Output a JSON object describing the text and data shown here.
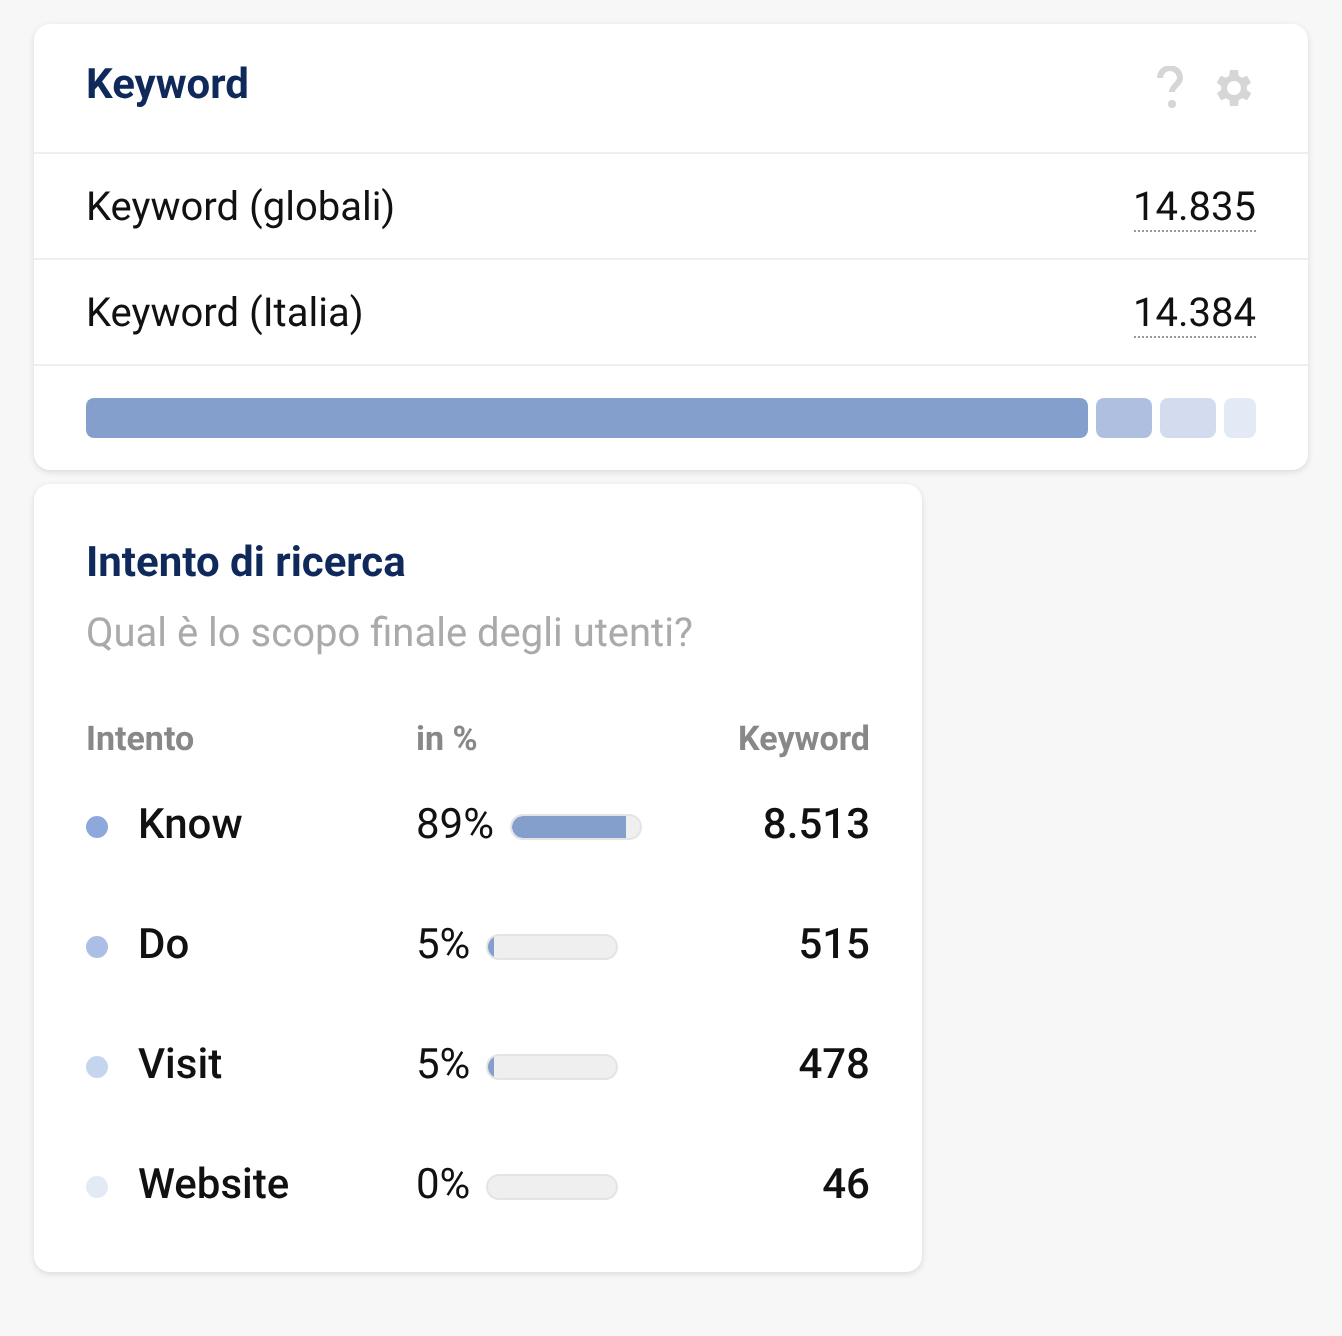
{
  "keyword_card": {
    "title": "Keyword",
    "rows": [
      {
        "label": "Keyword (globali)",
        "value": "14.835"
      },
      {
        "label": "Keyword (Italia)",
        "value": "14.384"
      }
    ],
    "distribution": [
      {
        "color": "#859fcc"
      },
      {
        "color": "#aebfdf"
      },
      {
        "color": "#d3dcee"
      },
      {
        "color": "#e3eaf5"
      }
    ]
  },
  "intent_card": {
    "title": "Intento di ricerca",
    "subtitle": "Qual è lo scopo finale degli utenti?",
    "columns": [
      "Intento",
      "in %",
      "Keyword"
    ],
    "rows": [
      {
        "name": "Know",
        "percent": "89%",
        "level": 0.89,
        "keywords": "8.513",
        "color": "#8ea8dc"
      },
      {
        "name": "Do",
        "percent": "5%",
        "level": 0.05,
        "keywords": "515",
        "color": "#aabee6"
      },
      {
        "name": "Visit",
        "percent": "5%",
        "level": 0.05,
        "keywords": "478",
        "color": "#c6d5ee"
      },
      {
        "name": "Website",
        "percent": "0%",
        "keywords": "46",
        "color": "#e2eaf6"
      }
    ]
  }
}
